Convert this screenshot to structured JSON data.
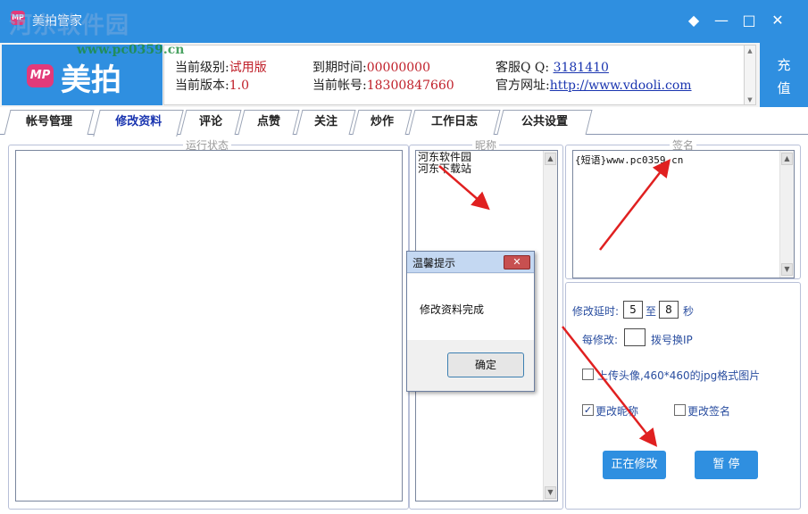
{
  "window": {
    "title": "美拍管家",
    "watermark": "河东软件园",
    "watermark_url": "www.pc0359.cn",
    "buttons": {
      "skin": "◆",
      "minimize": "—",
      "maximize": "□",
      "close": "✕"
    }
  },
  "logo": {
    "badge": "MP",
    "text": "美拍"
  },
  "info": {
    "level_label": "当前级别:",
    "level_value": "试用版",
    "version_label": "当前版本:",
    "version_value": "1.0",
    "expiry_label": "到期时间:",
    "expiry_value": "00000000",
    "account_label": "当前帐号:",
    "account_value": "18300847660",
    "qq_label": "客服Q Q:",
    "qq_value": "3181410",
    "site_label": "官方网址:",
    "site_value": "http://www.vdooli.com"
  },
  "recharge": {
    "line1": "充",
    "line2": "值"
  },
  "tabs": [
    {
      "label": "帐号管理"
    },
    {
      "label": "修改资料"
    },
    {
      "label": "评论"
    },
    {
      "label": "点赞"
    },
    {
      "label": "关注"
    },
    {
      "label": "炒作"
    },
    {
      "label": "工作日志"
    },
    {
      "label": "公共设置"
    }
  ],
  "panels": {
    "status_title": "运行状态",
    "nickname_title": "昵称",
    "nicknames": [
      "河东软件园",
      "河东下载站"
    ],
    "signature_title": "签名",
    "signature_text": "{短语}www.pc0359.cn"
  },
  "settings": {
    "delay_label": "修改延时:",
    "delay_from": "5",
    "delay_to_label": "至",
    "delay_to": "8",
    "delay_unit": "秒",
    "per_label": "每修改:",
    "per_value": "",
    "per_suffix": "拨号换IP",
    "avatar_label": "上传头像,460*460的jpg格式图片",
    "avatar_checked": false,
    "nick_label": "更改昵称",
    "nick_checked": true,
    "sig_label": "更改签名",
    "sig_checked": false,
    "start_button": "正在修改",
    "pause_button": "暂 停"
  },
  "dialog": {
    "title": "温馨提示",
    "close": "✕",
    "message": "修改资料完成",
    "ok": "确定"
  },
  "colors": {
    "accent": "#2f8fe0",
    "value_red": "#c0202a",
    "link_blue": "#1a35b0",
    "arrow": "#e02020"
  }
}
